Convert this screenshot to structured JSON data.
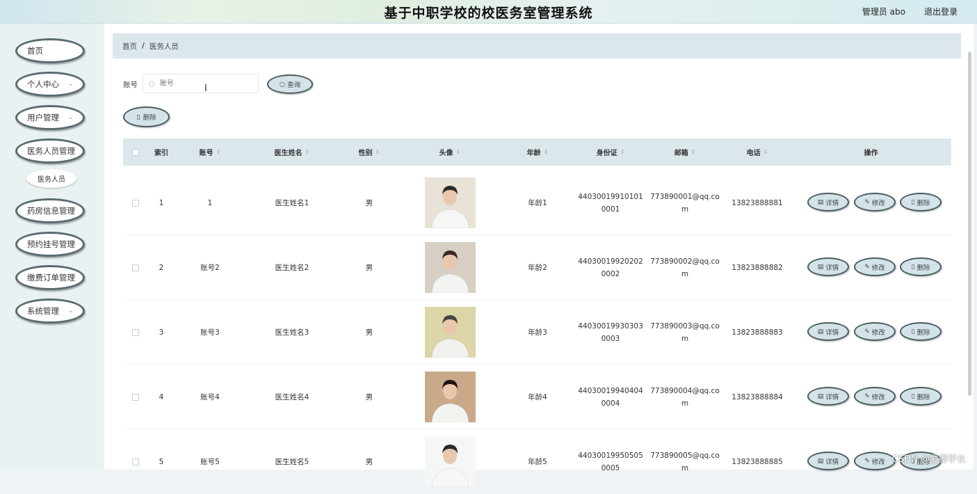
{
  "header": {
    "title": "基于中职学校的校医务室管理系统",
    "user": "管理员 abo",
    "logout": "退出登录"
  },
  "sidebar": {
    "items": [
      {
        "label": "首页",
        "has_chevron": false
      },
      {
        "label": "个人中心",
        "has_chevron": true
      },
      {
        "label": "用户管理",
        "has_chevron": true
      },
      {
        "label": "医务人员管理",
        "has_chevron": false
      },
      {
        "label": "药房信息管理",
        "has_chevron": false
      },
      {
        "label": "预约挂号管理",
        "has_chevron": false
      },
      {
        "label": "缴费订单管理",
        "has_chevron": false
      },
      {
        "label": "系统管理",
        "has_chevron": true
      }
    ],
    "sub_item": "医务人员"
  },
  "breadcrumb": {
    "home": "首页",
    "separator": "/",
    "current": "医务人员"
  },
  "search": {
    "label": "账号",
    "placeholder": "账号",
    "button": "查询"
  },
  "toolbar": {
    "delete": "删除"
  },
  "table": {
    "columns": [
      "索引",
      "账号",
      "医生姓名",
      "性别",
      "头像",
      "年龄",
      "身份证",
      "邮箱",
      "电话",
      "操作"
    ],
    "actions": {
      "detail": "详情",
      "edit": "修改",
      "delete": "删除"
    },
    "rows": [
      {
        "index": "1",
        "account": "1",
        "name": "医生姓名1",
        "gender": "男",
        "age": "年龄1",
        "id_card": "440300199101010001",
        "email": "773890001@qq.com",
        "phone": "13823888881"
      },
      {
        "index": "2",
        "account": "账号2",
        "name": "医生姓名2",
        "gender": "男",
        "age": "年龄2",
        "id_card": "440300199202020002",
        "email": "773890002@qq.com",
        "phone": "13823888882"
      },
      {
        "index": "3",
        "account": "账号3",
        "name": "医生姓名3",
        "gender": "男",
        "age": "年龄3",
        "id_card": "440300199303030003",
        "email": "773890003@qq.com",
        "phone": "13823888883"
      },
      {
        "index": "4",
        "account": "账号4",
        "name": "医生姓名4",
        "gender": "男",
        "age": "年龄4",
        "id_card": "440300199404040004",
        "email": "773890004@qq.com",
        "phone": "13823888884"
      },
      {
        "index": "5",
        "account": "账号5",
        "name": "医生姓名5",
        "gender": "男",
        "age": "年龄5",
        "id_card": "440300199505050005",
        "email": "773890005@qq.com",
        "phone": "13823888885"
      }
    ]
  },
  "watermark": "CSDN @爱得学长",
  "colors": {
    "accent": "#dce7ec",
    "button_fill": "#d4e3e8",
    "button_border": "#4c5d62"
  },
  "icons": {
    "search": "search-icon",
    "delete": "trash-icon",
    "detail": "document-icon",
    "edit": "pencil-icon",
    "sort": "sort-icon"
  }
}
